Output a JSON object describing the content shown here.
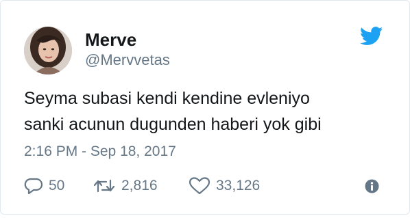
{
  "user": {
    "display_name": "Merve",
    "handle": "@Mervvetas"
  },
  "tweet": {
    "lines": [
      "Seyma subasi kendi kendine evleniyo",
      "sanki acunun dugunden haberi yok gibi"
    ],
    "timestamp": "2:16 PM - Sep 18, 2017"
  },
  "actions": {
    "replies": "50",
    "retweets": "2,816",
    "likes": "33,126"
  },
  "icons": {
    "brand": "twitter-bird-icon",
    "reply": "reply-icon",
    "retweet": "retweet-icon",
    "like": "heart-icon",
    "info": "info-icon"
  },
  "colors": {
    "brand": "#1da1f2",
    "text": "#14171a",
    "secondary": "#657786"
  }
}
